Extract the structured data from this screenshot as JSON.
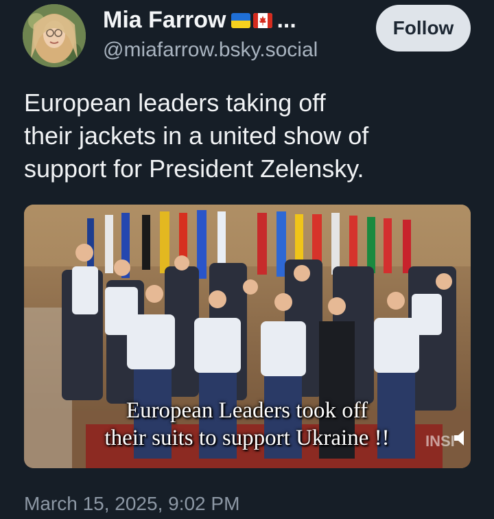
{
  "author": {
    "display_name": "Mia Farrow",
    "truncation": "...",
    "handle": "@miafarrow.bsky.social",
    "flags": [
      "ukraine-flag-icon",
      "canada-flag-icon"
    ]
  },
  "follow_button": {
    "label": "Follow"
  },
  "post": {
    "text_lines": [
      "European leaders taking off",
      "their jackets in a united show of",
      "support for President Zelensky."
    ],
    "timestamp": "March 15, 2025, 9:02 PM"
  },
  "media": {
    "caption_lines": [
      "European Leaders took off",
      "their suits to support Ukraine !!"
    ],
    "watermark": "INSI"
  },
  "colors": {
    "background": "#161e27",
    "follow_bg": "#dfe4ea",
    "handle": "#a9b4c0",
    "timestamp": "#8d98a5"
  }
}
